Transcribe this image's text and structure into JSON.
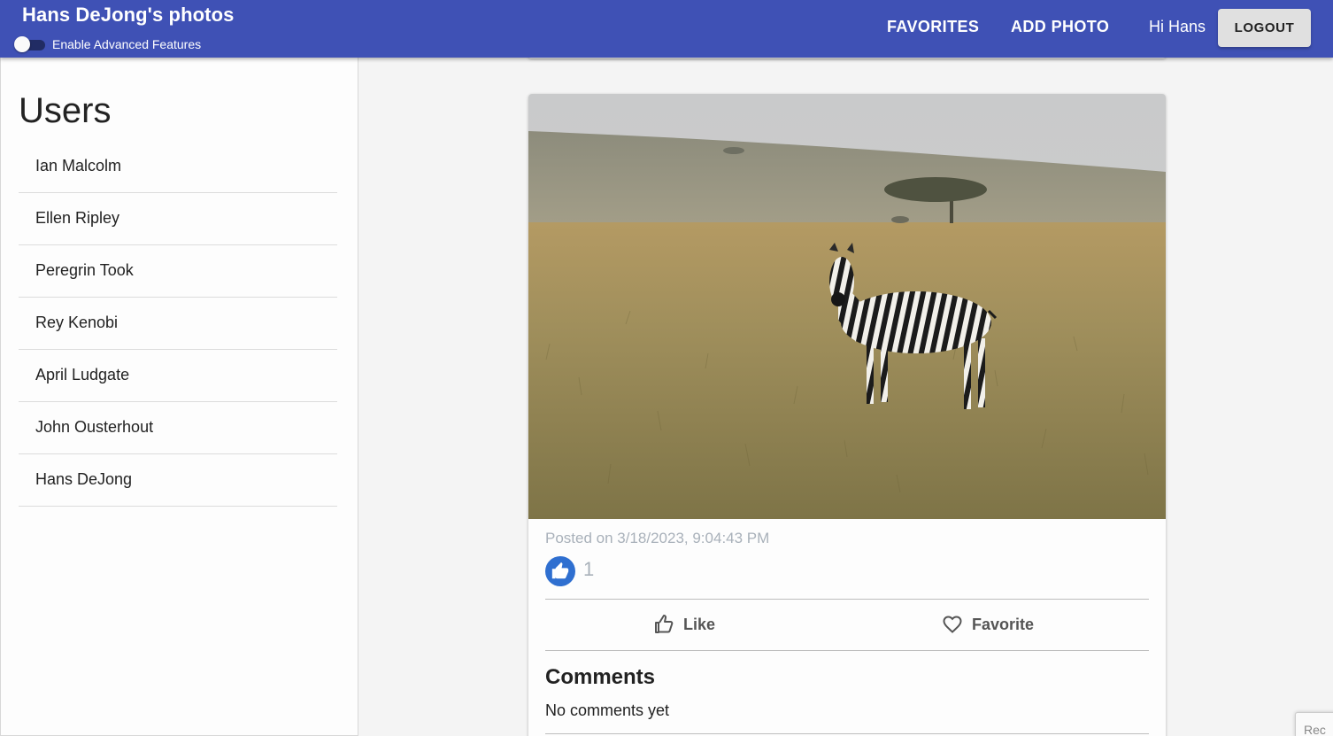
{
  "appbar": {
    "title": "Hans DeJong's photos",
    "toggle_label": "Enable Advanced Features",
    "toggle_on": false,
    "favorites_label": "FAVORITES",
    "add_photo_label": "ADD PHOTO",
    "greeting": "Hi Hans",
    "logout_label": "LOGOUT",
    "color": "#3f51b5"
  },
  "sidebar": {
    "title": "Users",
    "users": [
      {
        "name": "Ian Malcolm"
      },
      {
        "name": "Ellen Ripley"
      },
      {
        "name": "Peregrin Took"
      },
      {
        "name": "Rey Kenobi"
      },
      {
        "name": "April Ludgate"
      },
      {
        "name": "John Ousterhout"
      },
      {
        "name": "Hans DeJong"
      }
    ]
  },
  "post": {
    "image_icon": "zebra-photo",
    "posted": "Posted on 3/18/2023, 9:04:43 PM",
    "like_count": "1",
    "like_label": "Like",
    "favorite_label": "Favorite",
    "comments_title": "Comments",
    "no_comments": "No comments yet",
    "like_color": "#2f6fd0"
  },
  "corner_badge": "Rec"
}
